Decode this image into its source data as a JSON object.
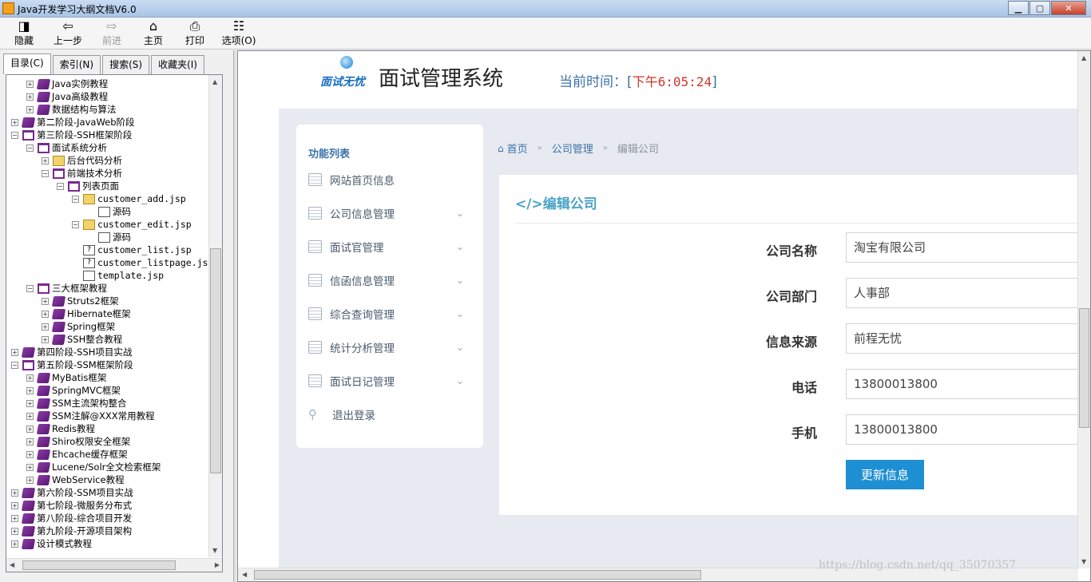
{
  "window": {
    "title": "Java开发学习大纲文档V6.0",
    "min": "▁",
    "max": "▢",
    "close": "✕"
  },
  "toolbar": [
    {
      "label": "隐藏",
      "icon": "hide-icon",
      "glyph": "◨",
      "enabled": true
    },
    {
      "label": "上一步",
      "icon": "back-arrow-icon",
      "glyph": "⇦",
      "enabled": true
    },
    {
      "label": "前进",
      "icon": "forward-arrow-icon",
      "glyph": "⇨",
      "enabled": false
    },
    {
      "label": "主页",
      "icon": "home-icon",
      "glyph": "⌂",
      "enabled": true
    },
    {
      "label": "打印",
      "icon": "printer-icon",
      "glyph": "⎙",
      "enabled": true
    },
    {
      "label": "选项(O)",
      "icon": "options-icon",
      "glyph": "☷",
      "enabled": true
    }
  ],
  "sidebar": {
    "tabs": [
      "目录(C)",
      "索引(N)",
      "搜索(S)",
      "收藏夹(I)"
    ],
    "tree": [
      {
        "label": "Java实例教程",
        "level": 1,
        "exp": "+",
        "icon": "book"
      },
      {
        "label": "Java高级教程",
        "level": 1,
        "exp": "+",
        "icon": "book"
      },
      {
        "label": "数据结构与算法",
        "level": 1,
        "exp": "+",
        "icon": "book"
      },
      {
        "label": "第二阶段-JavaWeb阶段",
        "level": 0,
        "exp": "+",
        "icon": "book"
      },
      {
        "label": "第三阶段-SSH框架阶段",
        "level": 0,
        "exp": "-",
        "icon": "open"
      },
      {
        "label": "面试系统分析",
        "level": 1,
        "exp": "-",
        "icon": "open"
      },
      {
        "label": "后台代码分析",
        "level": 2,
        "exp": "+",
        "icon": "folder"
      },
      {
        "label": "前端技术分析",
        "level": 2,
        "exp": "-",
        "icon": "open"
      },
      {
        "label": "列表页面",
        "level": 3,
        "exp": "-",
        "icon": "open"
      },
      {
        "label": "customer_add.jsp",
        "level": 4,
        "exp": "-",
        "icon": "folder"
      },
      {
        "label": "源码",
        "level": 5,
        "exp": "",
        "icon": "doc"
      },
      {
        "label": "customer_edit.jsp",
        "level": 4,
        "exp": "-",
        "icon": "folder"
      },
      {
        "label": "源码",
        "level": 5,
        "exp": "",
        "icon": "doc"
      },
      {
        "label": "customer_list.jsp",
        "level": 4,
        "exp": "",
        "icon": "qdoc"
      },
      {
        "label": "customer_listpage.jsp",
        "level": 4,
        "exp": "",
        "icon": "qdoc"
      },
      {
        "label": "template.jsp",
        "level": 4,
        "exp": "",
        "icon": "doc"
      },
      {
        "label": "三大框架教程",
        "level": 1,
        "exp": "-",
        "icon": "open"
      },
      {
        "label": "Struts2框架",
        "level": 2,
        "exp": "+",
        "icon": "book"
      },
      {
        "label": "Hibernate框架",
        "level": 2,
        "exp": "+",
        "icon": "book"
      },
      {
        "label": "Spring框架",
        "level": 2,
        "exp": "+",
        "icon": "book"
      },
      {
        "label": "SSH整合教程",
        "level": 2,
        "exp": "+",
        "icon": "book"
      },
      {
        "label": "第四阶段-SSH项目实战",
        "level": 0,
        "exp": "+",
        "icon": "book"
      },
      {
        "label": "第五阶段-SSM框架阶段",
        "level": 0,
        "exp": "-",
        "icon": "open"
      },
      {
        "label": "MyBatis框架",
        "level": 1,
        "exp": "+",
        "icon": "book"
      },
      {
        "label": "SpringMVC框架",
        "level": 1,
        "exp": "+",
        "icon": "book"
      },
      {
        "label": "SSM主流架构整合",
        "level": 1,
        "exp": "+",
        "icon": "book"
      },
      {
        "label": "SSM注解@XXX常用教程",
        "level": 1,
        "exp": "+",
        "icon": "book"
      },
      {
        "label": "Redis教程",
        "level": 1,
        "exp": "+",
        "icon": "book"
      },
      {
        "label": "Shiro权限安全框架",
        "level": 1,
        "exp": "+",
        "icon": "book"
      },
      {
        "label": "Ehcache缓存框架",
        "level": 1,
        "exp": "+",
        "icon": "book"
      },
      {
        "label": "Lucene/Solr全文检索框架",
        "level": 1,
        "exp": "+",
        "icon": "book"
      },
      {
        "label": "WebService教程",
        "level": 1,
        "exp": "+",
        "icon": "book"
      },
      {
        "label": "第六阶段-SSM项目实战",
        "level": 0,
        "exp": "+",
        "icon": "book"
      },
      {
        "label": "第七阶段-微服务分布式",
        "level": 0,
        "exp": "+",
        "icon": "book"
      },
      {
        "label": "第八阶段-综合项目开发",
        "level": 0,
        "exp": "+",
        "icon": "book"
      },
      {
        "label": "第九阶段-开源项目架构",
        "level": 0,
        "exp": "+",
        "icon": "book"
      },
      {
        "label": "设计模式教程",
        "level": 0,
        "exp": "+",
        "icon": "book"
      }
    ]
  },
  "page": {
    "logo_text": "面试无忧",
    "system_title": "面试管理系统",
    "time_label": "当前时间：",
    "time_open": "[",
    "time_value": "下午6:05:24",
    "time_close": "]",
    "menu_title": "功能列表",
    "menu": [
      {
        "label": "网站首页信息",
        "has_chevron": false
      },
      {
        "label": "公司信息管理",
        "has_chevron": true
      },
      {
        "label": "面试官管理",
        "has_chevron": true
      },
      {
        "label": "信函信息管理",
        "has_chevron": true
      },
      {
        "label": "综合查询管理",
        "has_chevron": true
      },
      {
        "label": "统计分析管理",
        "has_chevron": true
      },
      {
        "label": "面试日记管理",
        "has_chevron": true
      }
    ],
    "logout": "退出登录",
    "breadcrumb": {
      "home": "首页",
      "section": "公司管理",
      "current": "编辑公司",
      "sep": "»"
    },
    "panel_title": "</>编辑公司",
    "fields": [
      {
        "label": "公司名称",
        "value": "淘宝有限公司"
      },
      {
        "label": "公司部门",
        "value": "人事部"
      },
      {
        "label": "信息来源",
        "value": "前程无忧"
      },
      {
        "label": "电话",
        "value": "13800013800"
      },
      {
        "label": "手机",
        "value": "13800013800"
      }
    ],
    "submit": "更新信息",
    "watermark": "https://blog.csdn.net/qq_35070357"
  },
  "colors": {
    "accent": "#1e8fd2",
    "time": "#d0352a",
    "title_blue": "#4aa3c8",
    "menu_text": "#4a5b6e",
    "bg": "#e7eaf0"
  }
}
